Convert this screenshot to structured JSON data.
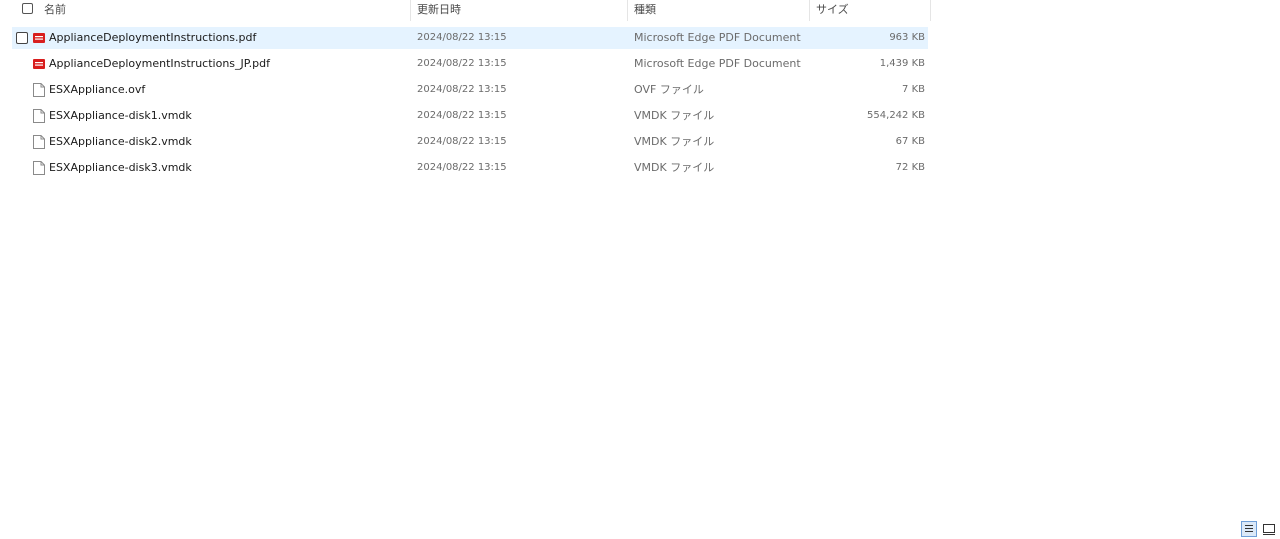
{
  "columns": {
    "name": "名前",
    "modified": "更新日時",
    "type": "種類",
    "size": "サイズ"
  },
  "files": [
    {
      "name": "ApplianceDeploymentInstructions.pdf",
      "modified": "2024/08/22 13:15",
      "type": "Microsoft Edge PDF Document",
      "size": "963 KB",
      "icon": "pdf-icon",
      "selected": true
    },
    {
      "name": "ApplianceDeploymentInstructions_JP.pdf",
      "modified": "2024/08/22 13:15",
      "type": "Microsoft Edge PDF Document",
      "size": "1,439 KB",
      "icon": "pdf-icon",
      "selected": false
    },
    {
      "name": "ESXAppliance.ovf",
      "modified": "2024/08/22 13:15",
      "type": "OVF ファイル",
      "size": "7 KB",
      "icon": "file-icon",
      "selected": false
    },
    {
      "name": "ESXAppliance-disk1.vmdk",
      "modified": "2024/08/22 13:15",
      "type": "VMDK ファイル",
      "size": "554,242 KB",
      "icon": "file-icon",
      "selected": false
    },
    {
      "name": "ESXAppliance-disk2.vmdk",
      "modified": "2024/08/22 13:15",
      "type": "VMDK ファイル",
      "size": "67 KB",
      "icon": "file-icon",
      "selected": false
    },
    {
      "name": "ESXAppliance-disk3.vmdk",
      "modified": "2024/08/22 13:15",
      "type": "VMDK ファイル",
      "size": "72 KB",
      "icon": "file-icon",
      "selected": false
    }
  ],
  "colors": {
    "selection": "#e5f3ff",
    "pdf_red": "#d81e1e",
    "secondary_text": "#6b6b6b"
  },
  "view_modes": {
    "details": "details-view-icon",
    "tiles": "tiles-view-icon",
    "active": "details"
  }
}
